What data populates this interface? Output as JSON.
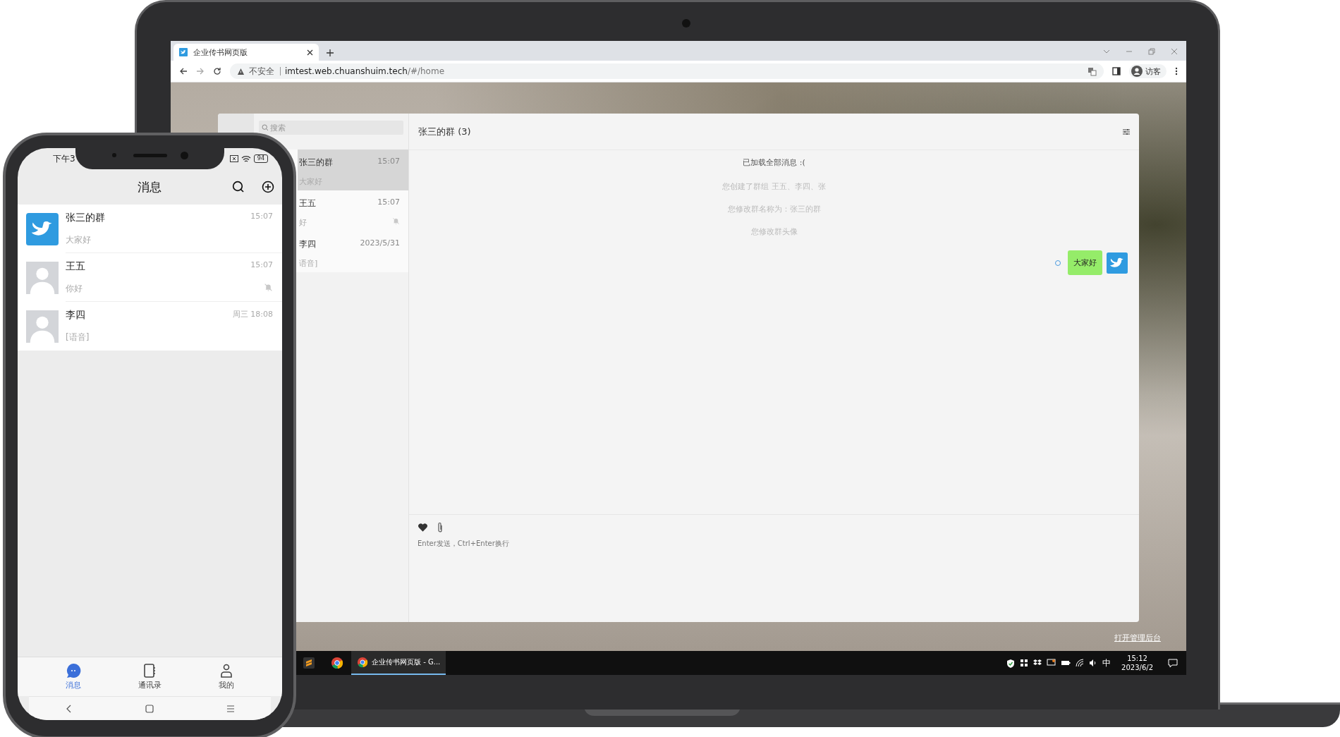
{
  "laptop": {
    "browser": {
      "tabs": [
        {
          "title": "企业传书网页版",
          "selected": true
        }
      ],
      "address_bar": {
        "security": "不安全",
        "url_host": "imtest.web.chuanshuim.tech",
        "url_path": "/#/home"
      },
      "profile": "访客"
    },
    "app": {
      "search": {
        "placeholder": "搜索"
      },
      "conversations": [
        {
          "name": "张三的群",
          "time": "15:07",
          "preview": "大家好",
          "selected": true,
          "muted": false
        },
        {
          "name": "王五",
          "time": "15:07",
          "preview": "好",
          "selected": false,
          "muted": true
        },
        {
          "name": "李四",
          "time": "2023/5/31",
          "preview": "语音]",
          "selected": false,
          "muted": false
        }
      ],
      "chat": {
        "title": "张三的群 (3)",
        "load_status": "已加载全部消息 :(",
        "messages": [
          {
            "kind": "system",
            "text": "您创建了群组 王五、李四、张"
          },
          {
            "kind": "system",
            "text": "您修改群名称为：张三的群"
          },
          {
            "kind": "system",
            "text": "您修改群头像"
          },
          {
            "kind": "outgoing",
            "text": "大家好"
          }
        ],
        "input": {
          "placeholder": "Enter发送，Ctrl+Enter换行"
        }
      }
    },
    "admin_link": "打开管理后台",
    "taskbar": {
      "windows": [
        {
          "title": "企业传书网页版 - G...",
          "selected": true
        }
      ],
      "ime": "中",
      "time": "15:12",
      "date": "2023/6/2"
    }
  },
  "phone": {
    "status_time": "下午3",
    "battery": "94",
    "title": "消息",
    "conversations": [
      {
        "kind": "group",
        "name": "张三的群",
        "preview": "大家好",
        "time": "15:07",
        "muted": false
      },
      {
        "kind": "person",
        "name": "王五",
        "preview": "你好",
        "time": "15:07",
        "muted": true
      },
      {
        "kind": "person",
        "name": "李四",
        "preview": "[语音]",
        "time": "周三 18:08",
        "muted": false
      }
    ],
    "tabs": [
      {
        "kind": "chat",
        "label": "消息",
        "selected": true
      },
      {
        "kind": "contacts",
        "label": "通讯录",
        "selected": false
      },
      {
        "kind": "profile",
        "label": "我的",
        "selected": false
      }
    ]
  }
}
